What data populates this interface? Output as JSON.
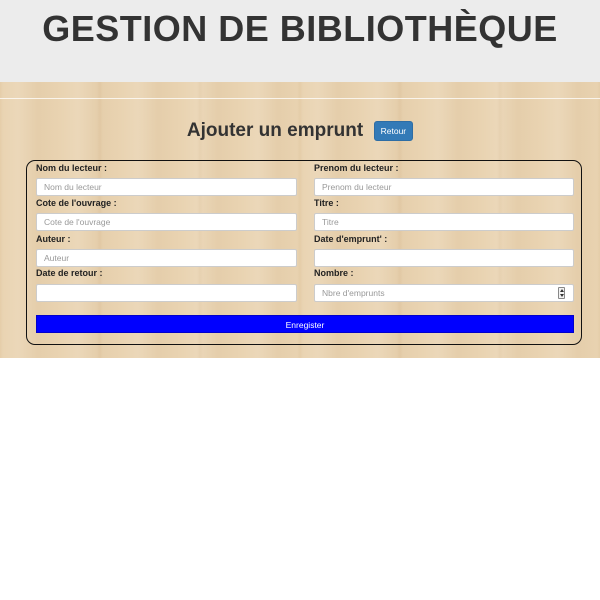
{
  "header": {
    "title": "GESTION DE BIBLIOTHÈQUE"
  },
  "page": {
    "subtitle": "Ajouter un emprunt",
    "back_button_label": "Retour"
  },
  "form": {
    "fields": {
      "nom_lecteur": {
        "label": "Nom du lecteur :",
        "placeholder": "Nom du lecteur",
        "value": ""
      },
      "prenom_lecteur": {
        "label": "Prenom du lecteur :",
        "placeholder": "Prenom du lecteur",
        "value": ""
      },
      "cote_ouvrage": {
        "label": "Cote de l'ouvrage :",
        "placeholder": "Cote de l'ouvrage",
        "value": ""
      },
      "titre": {
        "label": "Titre :",
        "placeholder": "Titre",
        "value": ""
      },
      "auteur": {
        "label": "Auteur :",
        "placeholder": "Auteur",
        "value": ""
      },
      "date_emprunt": {
        "label": "Date d'emprunt' :",
        "placeholder": "",
        "value": ""
      },
      "date_retour": {
        "label": "Date de retour :",
        "placeholder": "",
        "value": ""
      },
      "nombre": {
        "label": "Nombre :",
        "placeholder": "Nbre d'emprunts",
        "value": ""
      }
    },
    "submit_label": "Enregister"
  },
  "colors": {
    "header_bg": "#ececec",
    "wood_bg": "#e9d3b1",
    "back_button_bg": "#337ab7",
    "submit_button_bg": "#0000ff"
  },
  "icons": {
    "number_spinner": "spinner-arrows-icon"
  }
}
